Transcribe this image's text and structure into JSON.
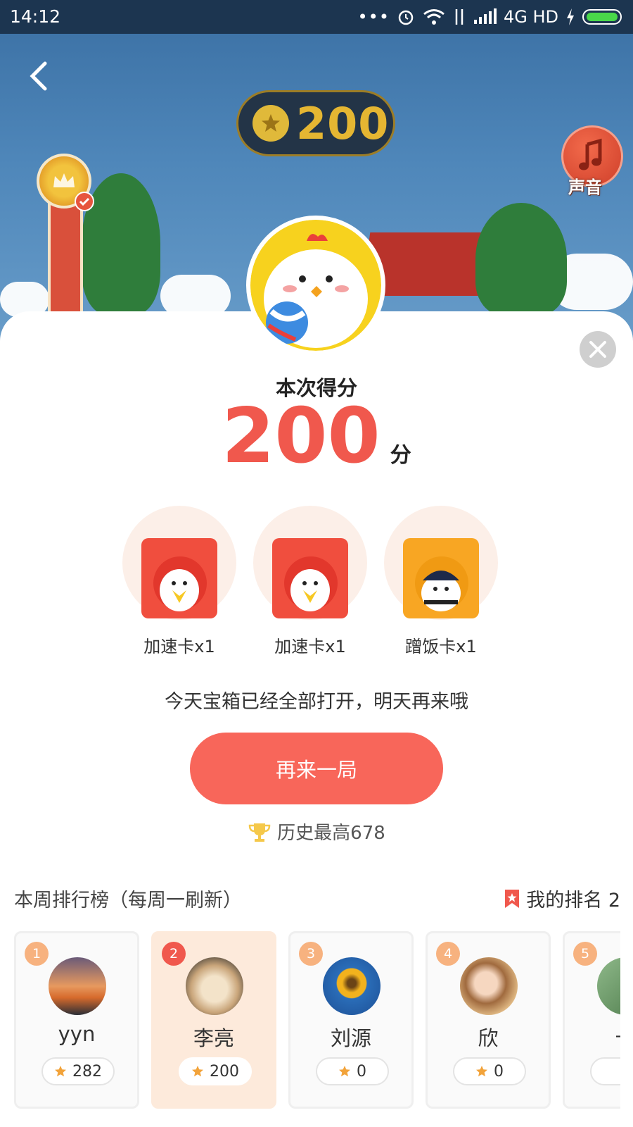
{
  "status_bar": {
    "time": "14:12",
    "network": "4G HD"
  },
  "game": {
    "coin_score": "200",
    "sound_label": "声音"
  },
  "result": {
    "title": "本次得分",
    "score": "200",
    "unit": "分",
    "rewards": [
      {
        "label": "加速卡x1",
        "color": "#f04e3e"
      },
      {
        "label": "加速卡x1",
        "color": "#f04e3e"
      },
      {
        "label": "蹭饭卡x1",
        "color": "#f8a623"
      }
    ],
    "notice": "今天宝箱已经全部打开，明天再来哦",
    "again_button": "再来一局",
    "best_score": "历史最高678"
  },
  "ranking": {
    "title": "本周排行榜（每周一刷新）",
    "my_rank_label": "我的排名 2",
    "entries": [
      {
        "rank": "1",
        "name": "yyn",
        "score": "282"
      },
      {
        "rank": "2",
        "name": "李亮",
        "score": "200"
      },
      {
        "rank": "3",
        "name": "刘源",
        "score": "0"
      },
      {
        "rank": "4",
        "name": "欣",
        "score": "0"
      },
      {
        "rank": "5",
        "name": "卡",
        "score": ""
      }
    ]
  },
  "colors": {
    "accent": "#f0584d",
    "button": "#f8665a",
    "gold": "#e5b632"
  }
}
